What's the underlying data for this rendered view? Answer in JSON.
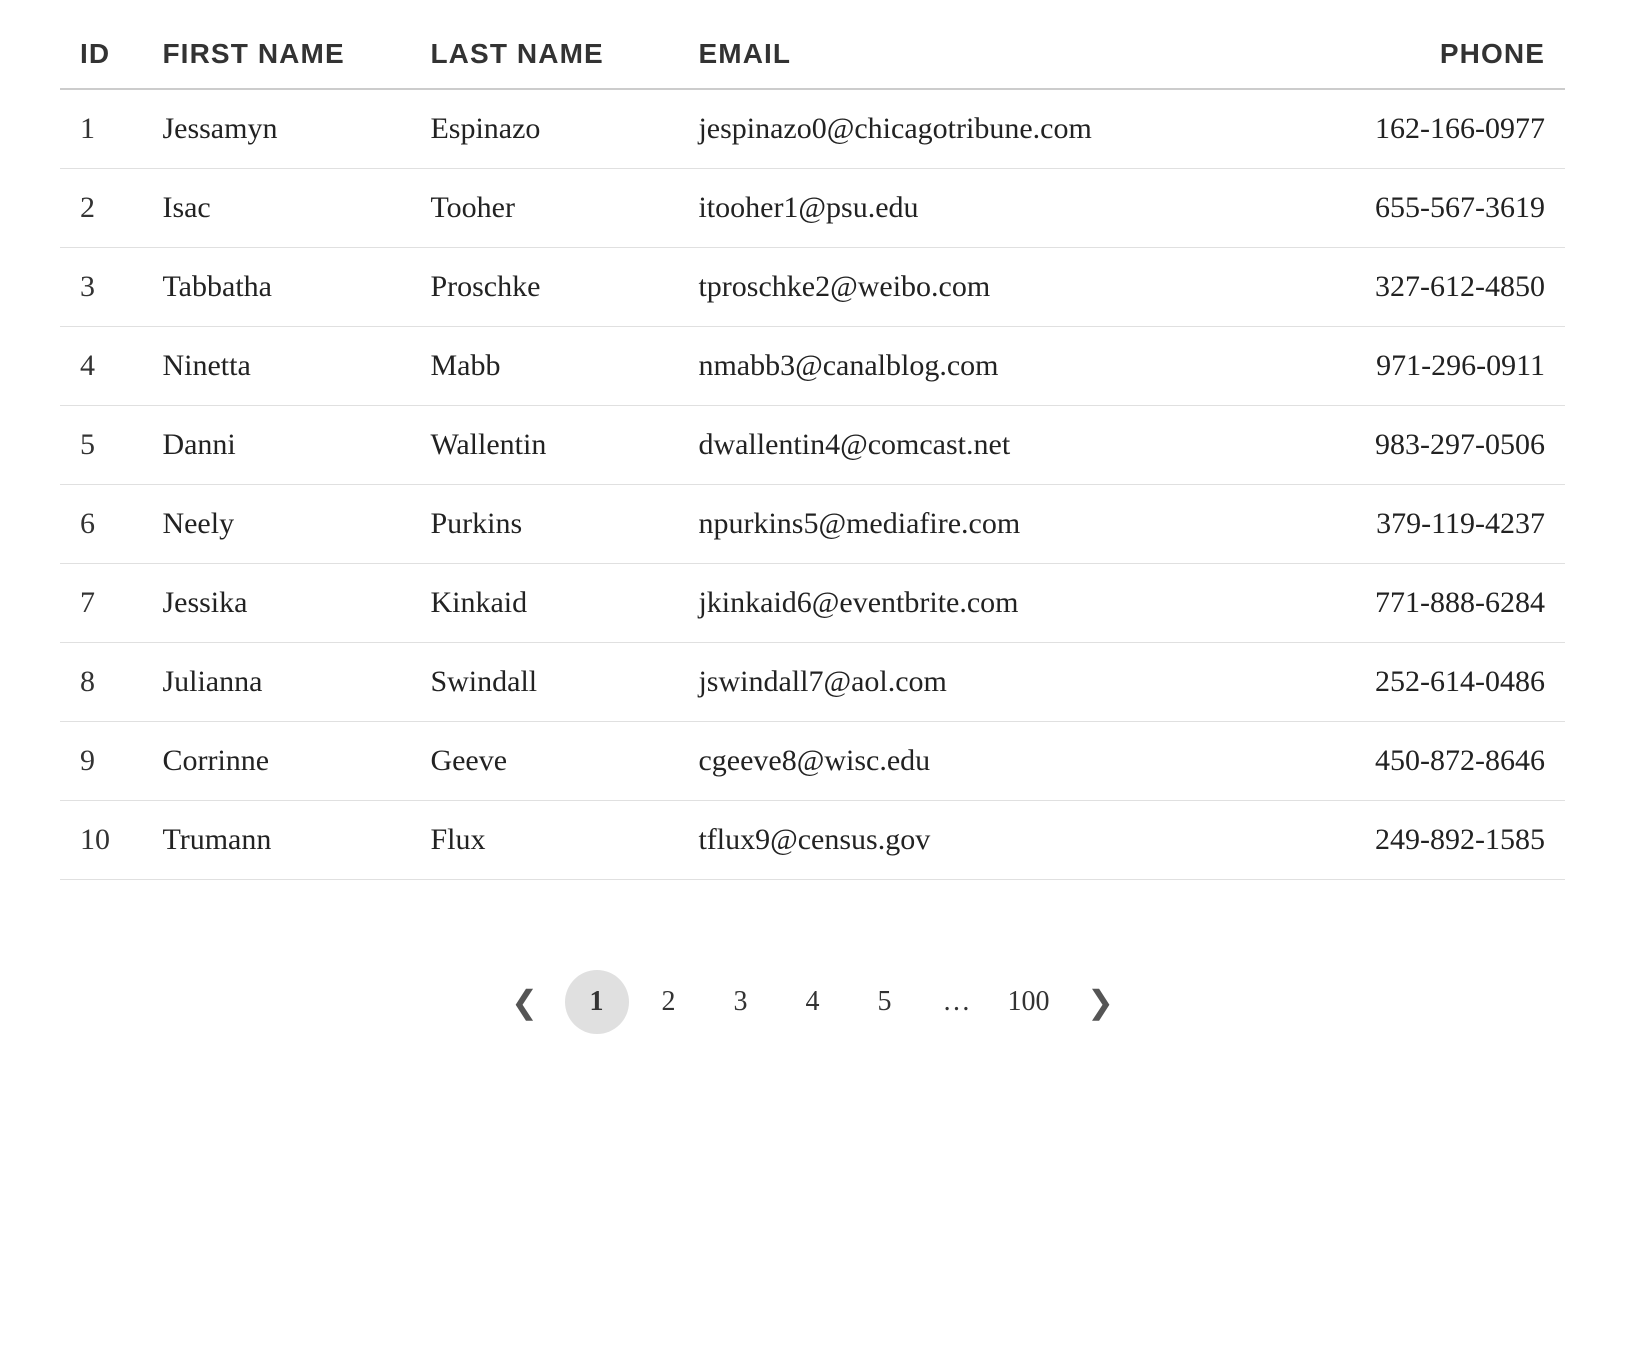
{
  "table": {
    "columns": [
      {
        "key": "id",
        "label": "ID"
      },
      {
        "key": "first_name",
        "label": "FIRST NAME"
      },
      {
        "key": "last_name",
        "label": "LAST NAME"
      },
      {
        "key": "email",
        "label": "EMAIL"
      },
      {
        "key": "phone",
        "label": "PHONE"
      }
    ],
    "rows": [
      {
        "id": 1,
        "first_name": "Jessamyn",
        "last_name": "Espinazo",
        "email": "jespinazo0@chicagotribune.com",
        "phone": "162-166-0977"
      },
      {
        "id": 2,
        "first_name": "Isac",
        "last_name": "Tooher",
        "email": "itooher1@psu.edu",
        "phone": "655-567-3619"
      },
      {
        "id": 3,
        "first_name": "Tabbatha",
        "last_name": "Proschke",
        "email": "tproschke2@weibo.com",
        "phone": "327-612-4850"
      },
      {
        "id": 4,
        "first_name": "Ninetta",
        "last_name": "Mabb",
        "email": "nmabb3@canalblog.com",
        "phone": "971-296-0911"
      },
      {
        "id": 5,
        "first_name": "Danni",
        "last_name": "Wallentin",
        "email": "dwallentin4@comcast.net",
        "phone": "983-297-0506"
      },
      {
        "id": 6,
        "first_name": "Neely",
        "last_name": "Purkins",
        "email": "npurkins5@mediafire.com",
        "phone": "379-119-4237"
      },
      {
        "id": 7,
        "first_name": "Jessika",
        "last_name": "Kinkaid",
        "email": "jkinkaid6@eventbrite.com",
        "phone": "771-888-6284"
      },
      {
        "id": 8,
        "first_name": "Julianna",
        "last_name": "Swindall",
        "email": "jswindall7@aol.com",
        "phone": "252-614-0486"
      },
      {
        "id": 9,
        "first_name": "Corrinne",
        "last_name": "Geeve",
        "email": "cgeeve8@wisc.edu",
        "phone": "450-872-8646"
      },
      {
        "id": 10,
        "first_name": "Trumann",
        "last_name": "Flux",
        "email": "tflux9@census.gov",
        "phone": "249-892-1585"
      }
    ]
  },
  "pagination": {
    "prev_label": "‹",
    "next_label": "›",
    "current_page": 1,
    "pages": [
      1,
      2,
      3,
      4,
      5
    ],
    "ellipsis": "…",
    "last_page": 100
  }
}
